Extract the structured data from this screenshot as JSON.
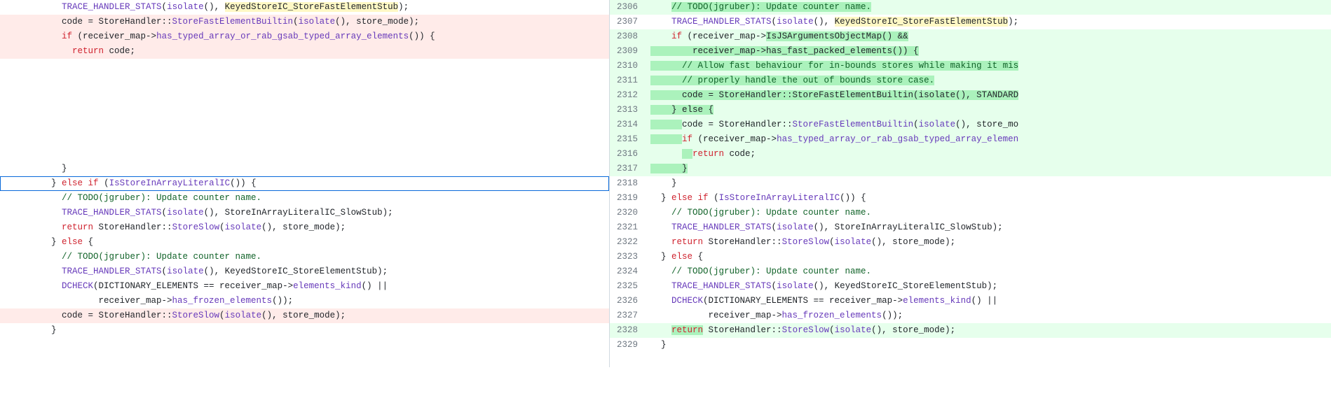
{
  "left": {
    "lines": [
      {
        "n": "",
        "bg": "",
        "segs": [
          {
            "t": "    ",
            "c": ""
          },
          {
            "t": "TRACE_HANDLER_STATS",
            "c": "tok-fn"
          },
          {
            "t": "(",
            "c": ""
          },
          {
            "t": "isolate",
            "c": "tok-fn"
          },
          {
            "t": "(), ",
            "c": ""
          },
          {
            "t": "KeyedStoreIC_StoreFastElementStub",
            "c": "hl"
          },
          {
            "t": ");",
            "c": ""
          }
        ]
      },
      {
        "n": "",
        "bg": "bg-del",
        "segs": [
          {
            "t": "    code = StoreHandler::",
            "c": ""
          },
          {
            "t": "StoreFastElementBuiltin",
            "c": "tok-fn"
          },
          {
            "t": "(",
            "c": ""
          },
          {
            "t": "isolate",
            "c": "tok-fn"
          },
          {
            "t": "(), store_mode);",
            "c": ""
          }
        ]
      },
      {
        "n": "",
        "bg": "bg-del",
        "segs": [
          {
            "t": "    ",
            "c": ""
          },
          {
            "t": "if",
            "c": "tok-k"
          },
          {
            "t": " (receiver_map->",
            "c": ""
          },
          {
            "t": "has_typed_array_or_rab_gsab_typed_array_elements",
            "c": "tok-fn"
          },
          {
            "t": "()) {",
            "c": ""
          }
        ]
      },
      {
        "n": "",
        "bg": "bg-del",
        "segs": [
          {
            "t": "      ",
            "c": ""
          },
          {
            "t": "return",
            "c": "tok-k"
          },
          {
            "t": " code;",
            "c": ""
          }
        ]
      },
      {
        "n": "",
        "bg": "",
        "segs": []
      },
      {
        "n": "",
        "bg": "",
        "segs": []
      },
      {
        "n": "",
        "bg": "",
        "segs": []
      },
      {
        "n": "",
        "bg": "",
        "segs": []
      },
      {
        "n": "",
        "bg": "",
        "segs": []
      },
      {
        "n": "",
        "bg": "",
        "segs": []
      },
      {
        "n": "",
        "bg": "",
        "segs": []
      },
      {
        "n": "",
        "bg": "",
        "segs": [
          {
            "t": "    }",
            "c": ""
          }
        ]
      },
      {
        "n": "",
        "bg": "",
        "sel": true,
        "segs": [
          {
            "t": "  } ",
            "c": ""
          },
          {
            "t": "else",
            "c": "tok-k"
          },
          {
            "t": " ",
            "c": ""
          },
          {
            "t": "if",
            "c": "tok-k"
          },
          {
            "t": " (",
            "c": ""
          },
          {
            "t": "IsStoreInArrayLiteralIC",
            "c": "tok-fn"
          },
          {
            "t": "()) {",
            "c": ""
          }
        ]
      },
      {
        "n": "",
        "bg": "",
        "segs": [
          {
            "t": "    ",
            "c": ""
          },
          {
            "t": "// TODO(jgruber): Update counter name.",
            "c": "tok-c"
          }
        ]
      },
      {
        "n": "",
        "bg": "",
        "segs": [
          {
            "t": "    ",
            "c": ""
          },
          {
            "t": "TRACE_HANDLER_STATS",
            "c": "tok-fn"
          },
          {
            "t": "(",
            "c": ""
          },
          {
            "t": "isolate",
            "c": "tok-fn"
          },
          {
            "t": "(), StoreInArrayLiteralIC_SlowStub);",
            "c": ""
          }
        ]
      },
      {
        "n": "",
        "bg": "",
        "segs": [
          {
            "t": "    ",
            "c": ""
          },
          {
            "t": "return",
            "c": "tok-k"
          },
          {
            "t": " StoreHandler::",
            "c": ""
          },
          {
            "t": "StoreSlow",
            "c": "tok-fn"
          },
          {
            "t": "(",
            "c": ""
          },
          {
            "t": "isolate",
            "c": "tok-fn"
          },
          {
            "t": "(), store_mode);",
            "c": ""
          }
        ]
      },
      {
        "n": "",
        "bg": "",
        "segs": [
          {
            "t": "  } ",
            "c": ""
          },
          {
            "t": "else",
            "c": "tok-k"
          },
          {
            "t": " {",
            "c": ""
          }
        ]
      },
      {
        "n": "",
        "bg": "",
        "segs": [
          {
            "t": "    ",
            "c": ""
          },
          {
            "t": "// TODO(jgruber): Update counter name.",
            "c": "tok-c"
          }
        ]
      },
      {
        "n": "",
        "bg": "",
        "segs": [
          {
            "t": "    ",
            "c": ""
          },
          {
            "t": "TRACE_HANDLER_STATS",
            "c": "tok-fn"
          },
          {
            "t": "(",
            "c": ""
          },
          {
            "t": "isolate",
            "c": "tok-fn"
          },
          {
            "t": "(), KeyedStoreIC_StoreElementStub);",
            "c": ""
          }
        ]
      },
      {
        "n": "",
        "bg": "",
        "segs": [
          {
            "t": "    ",
            "c": ""
          },
          {
            "t": "DCHECK",
            "c": "tok-fn"
          },
          {
            "t": "(DICTIONARY_ELEMENTS == receiver_map->",
            "c": ""
          },
          {
            "t": "elements_kind",
            "c": "tok-fn"
          },
          {
            "t": "() ||",
            "c": ""
          }
        ]
      },
      {
        "n": "",
        "bg": "",
        "segs": [
          {
            "t": "           receiver_map->",
            "c": ""
          },
          {
            "t": "has_frozen_elements",
            "c": "tok-fn"
          },
          {
            "t": "());",
            "c": ""
          }
        ]
      },
      {
        "n": "",
        "bg": "bg-del",
        "segs": [
          {
            "t": "    code = StoreHandler::",
            "c": ""
          },
          {
            "t": "StoreSlow",
            "c": "tok-fn"
          },
          {
            "t": "(",
            "c": ""
          },
          {
            "t": "isolate",
            "c": "tok-fn"
          },
          {
            "t": "(), store_mode);",
            "c": ""
          }
        ]
      },
      {
        "n": "",
        "bg": "",
        "segs": [
          {
            "t": "  }",
            "c": ""
          }
        ]
      },
      {
        "n": "",
        "bg": "",
        "segs": []
      }
    ]
  },
  "right": {
    "lines": [
      {
        "n": "2306",
        "bg": "bg-add",
        "segs": [
          {
            "t": "    ",
            "c": ""
          },
          {
            "t": "// TODO(jgruber): Update counter name.",
            "c": "tok-c bg-add-strong"
          }
        ]
      },
      {
        "n": "2307",
        "bg": "",
        "segs": [
          {
            "t": "    ",
            "c": ""
          },
          {
            "t": "TRACE_HANDLER_STATS",
            "c": "tok-fn"
          },
          {
            "t": "(",
            "c": ""
          },
          {
            "t": "isolate",
            "c": "tok-fn"
          },
          {
            "t": "(), ",
            "c": ""
          },
          {
            "t": "KeyedStoreIC_StoreFastElementStub",
            "c": "hl"
          },
          {
            "t": ");",
            "c": ""
          }
        ]
      },
      {
        "n": "2308",
        "bg": "bg-add",
        "segs": [
          {
            "t": "    ",
            "c": ""
          },
          {
            "t": "if",
            "c": "tok-k"
          },
          {
            "t": " (receiver_map->",
            "c": ""
          },
          {
            "t": "IsJSArgumentsObjectMap() &&",
            "c": "bg-add-strong"
          }
        ]
      },
      {
        "n": "2309",
        "bg": "bg-add",
        "segs": [
          {
            "t": "        receiver_map->has_fast_packed_elements()) {",
            "c": "bg-add-strong"
          }
        ]
      },
      {
        "n": "2310",
        "bg": "bg-add",
        "segs": [
          {
            "t": "      ",
            "c": "bg-add-strong"
          },
          {
            "t": "// Allow fast behaviour for in-bounds stores while making it mis",
            "c": "tok-c bg-add-strong"
          }
        ]
      },
      {
        "n": "2311",
        "bg": "bg-add",
        "segs": [
          {
            "t": "      ",
            "c": "bg-add-strong"
          },
          {
            "t": "// properly handle the out of bounds store case.",
            "c": "tok-c bg-add-strong"
          }
        ]
      },
      {
        "n": "2312",
        "bg": "bg-add",
        "segs": [
          {
            "t": "      code = StoreHandler::StoreFastElementBuiltin(isolate(), STANDARD",
            "c": "bg-add-strong"
          }
        ]
      },
      {
        "n": "2313",
        "bg": "bg-add",
        "segs": [
          {
            "t": "    } else {",
            "c": "bg-add-strong"
          }
        ]
      },
      {
        "n": "2314",
        "bg": "bg-add",
        "segs": [
          {
            "t": "      ",
            "c": "bg-add-strong"
          },
          {
            "t": "code = StoreHandler::",
            "c": ""
          },
          {
            "t": "StoreFastElementBuiltin",
            "c": "tok-fn"
          },
          {
            "t": "(",
            "c": ""
          },
          {
            "t": "isolate",
            "c": "tok-fn"
          },
          {
            "t": "(), store_mo",
            "c": ""
          }
        ]
      },
      {
        "n": "2315",
        "bg": "bg-add",
        "segs": [
          {
            "t": "      ",
            "c": "bg-add-strong"
          },
          {
            "t": "if",
            "c": "tok-k"
          },
          {
            "t": " (receiver_map->",
            "c": ""
          },
          {
            "t": "has_typed_array_or_rab_gsab_typed_array_elemen",
            "c": "tok-fn"
          }
        ]
      },
      {
        "n": "2316",
        "bg": "bg-add",
        "segs": [
          {
            "t": "      ",
            "c": ""
          },
          {
            "t": "  ",
            "c": "bg-add-strong"
          },
          {
            "t": "return",
            "c": "tok-k"
          },
          {
            "t": " code;",
            "c": ""
          }
        ]
      },
      {
        "n": "2317",
        "bg": "bg-add",
        "segs": [
          {
            "t": "      ",
            "c": "bg-add-strong"
          },
          {
            "t": "}",
            "c": "bg-add-strong"
          }
        ]
      },
      {
        "n": "2318",
        "bg": "",
        "segs": [
          {
            "t": "    }",
            "c": ""
          }
        ]
      },
      {
        "n": "2319",
        "bg": "",
        "segs": [
          {
            "t": "  } ",
            "c": ""
          },
          {
            "t": "else",
            "c": "tok-k"
          },
          {
            "t": " ",
            "c": ""
          },
          {
            "t": "if",
            "c": "tok-k"
          },
          {
            "t": " (",
            "c": ""
          },
          {
            "t": "IsStoreInArrayLiteralIC",
            "c": "tok-fn"
          },
          {
            "t": "()) {",
            "c": ""
          }
        ]
      },
      {
        "n": "2320",
        "bg": "",
        "segs": [
          {
            "t": "    ",
            "c": ""
          },
          {
            "t": "// TODO(jgruber): Update counter name.",
            "c": "tok-c"
          }
        ]
      },
      {
        "n": "2321",
        "bg": "",
        "segs": [
          {
            "t": "    ",
            "c": ""
          },
          {
            "t": "TRACE_HANDLER_STATS",
            "c": "tok-fn"
          },
          {
            "t": "(",
            "c": ""
          },
          {
            "t": "isolate",
            "c": "tok-fn"
          },
          {
            "t": "(), StoreInArrayLiteralIC_SlowStub);",
            "c": ""
          }
        ]
      },
      {
        "n": "2322",
        "bg": "",
        "segs": [
          {
            "t": "    ",
            "c": ""
          },
          {
            "t": "return",
            "c": "tok-k"
          },
          {
            "t": " StoreHandler::",
            "c": ""
          },
          {
            "t": "StoreSlow",
            "c": "tok-fn"
          },
          {
            "t": "(",
            "c": ""
          },
          {
            "t": "isolate",
            "c": "tok-fn"
          },
          {
            "t": "(), store_mode);",
            "c": ""
          }
        ]
      },
      {
        "n": "2323",
        "bg": "",
        "segs": [
          {
            "t": "  } ",
            "c": ""
          },
          {
            "t": "else",
            "c": "tok-k"
          },
          {
            "t": " {",
            "c": ""
          }
        ]
      },
      {
        "n": "2324",
        "bg": "",
        "segs": [
          {
            "t": "    ",
            "c": ""
          },
          {
            "t": "// TODO(jgruber): Update counter name.",
            "c": "tok-c"
          }
        ]
      },
      {
        "n": "2325",
        "bg": "",
        "segs": [
          {
            "t": "    ",
            "c": ""
          },
          {
            "t": "TRACE_HANDLER_STATS",
            "c": "tok-fn"
          },
          {
            "t": "(",
            "c": ""
          },
          {
            "t": "isolate",
            "c": "tok-fn"
          },
          {
            "t": "(), KeyedStoreIC_StoreElementStub);",
            "c": ""
          }
        ]
      },
      {
        "n": "2326",
        "bg": "",
        "segs": [
          {
            "t": "    ",
            "c": ""
          },
          {
            "t": "DCHECK",
            "c": "tok-fn"
          },
          {
            "t": "(DICTIONARY_ELEMENTS == receiver_map->",
            "c": ""
          },
          {
            "t": "elements_kind",
            "c": "tok-fn"
          },
          {
            "t": "() ||",
            "c": ""
          }
        ]
      },
      {
        "n": "2327",
        "bg": "",
        "segs": [
          {
            "t": "           receiver_map->",
            "c": ""
          },
          {
            "t": "has_frozen_elements",
            "c": "tok-fn"
          },
          {
            "t": "());",
            "c": ""
          }
        ]
      },
      {
        "n": "2328",
        "bg": "bg-add",
        "segs": [
          {
            "t": "    ",
            "c": ""
          },
          {
            "t": "return",
            "c": "bg-add-strong tok-k"
          },
          {
            "t": " StoreHandler::",
            "c": ""
          },
          {
            "t": "StoreSlow",
            "c": "tok-fn"
          },
          {
            "t": "(",
            "c": ""
          },
          {
            "t": "isolate",
            "c": "tok-fn"
          },
          {
            "t": "(), store_mode);",
            "c": ""
          }
        ]
      },
      {
        "n": "2329",
        "bg": "",
        "segs": [
          {
            "t": "  }",
            "c": ""
          }
        ]
      },
      {
        "n": "",
        "bg": "",
        "segs": []
      }
    ]
  }
}
